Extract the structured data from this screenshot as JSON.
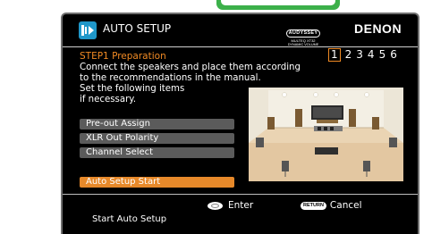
{
  "header": {
    "title": "AUTO SETUP",
    "audyssey_logo": {
      "line1": "AUDYSSEY",
      "line2": "MULTEQ XT32",
      "line3": "DYNAMIC VOLUME"
    },
    "brand": "DENON"
  },
  "step": {
    "title": "STEP1 Preparation",
    "current": "1",
    "indicators": [
      "1",
      "2",
      "3",
      "4",
      "5",
      "6"
    ]
  },
  "instructions": [
    "Connect the speakers and place them according",
    "to the recommendations in the manual.",
    "Set the following items",
    "if necessary."
  ],
  "menu": {
    "items": [
      "Pre-out Assign",
      "XLR Out Polarity",
      "Channel Select"
    ],
    "start_label": "Auto Setup Start"
  },
  "illustration": {
    "icon": "speaker-room-illustration"
  },
  "footer": {
    "enter_label": "Enter",
    "return_icon_text": "RETURN",
    "cancel_label": "Cancel",
    "status": "Start Auto Setup"
  },
  "colors": {
    "accent": "#e7892a",
    "step_title": "#f08a24",
    "button": "#5b5b5b",
    "frame_tab": "#3cb04a",
    "icon_bg": "#1f97c9"
  }
}
